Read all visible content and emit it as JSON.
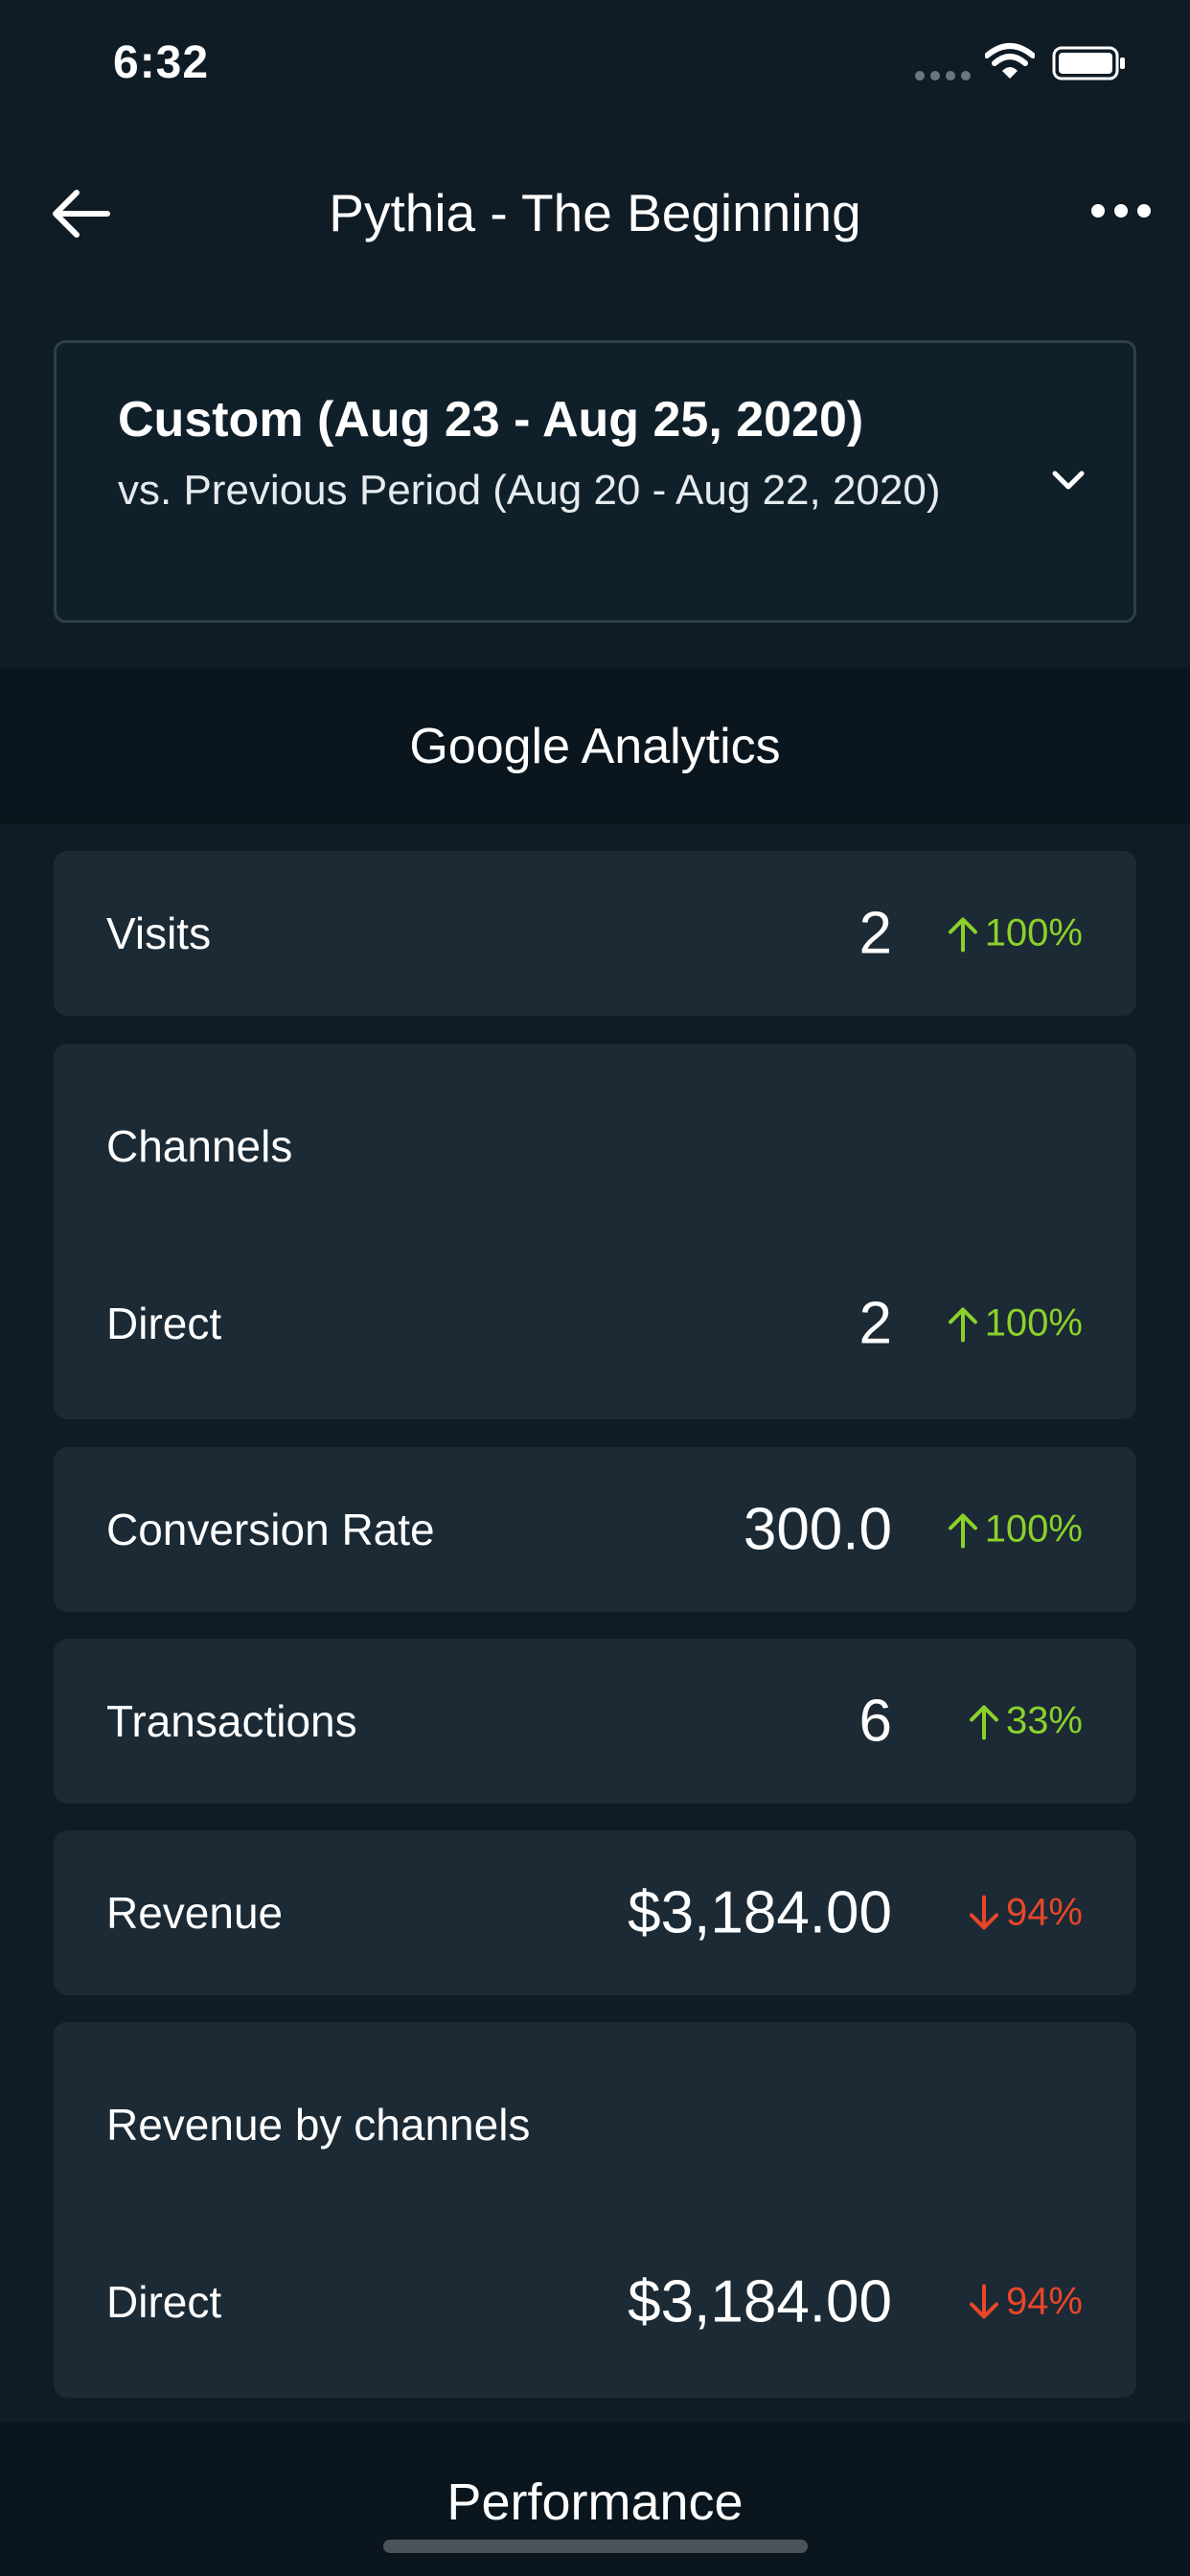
{
  "status_bar": {
    "time": "6:32"
  },
  "header": {
    "title": "Pythia - The Beginning"
  },
  "date_range": {
    "primary": "Custom (Aug 23 - Aug 25, 2020)",
    "comparison": "vs. Previous Period (Aug 20 - Aug 22, 2020)"
  },
  "section": {
    "title": "Google Analytics"
  },
  "metrics": {
    "visits": {
      "label": "Visits",
      "value": "2",
      "delta": "100%",
      "direction": "up"
    },
    "channels": {
      "title": "Channels",
      "rows": [
        {
          "label": "Direct",
          "value": "2",
          "delta": "100%",
          "direction": "up"
        }
      ]
    },
    "conversion_rate": {
      "label": "Conversion Rate",
      "value": "300.0",
      "delta": "100%",
      "direction": "up"
    },
    "transactions": {
      "label": "Transactions",
      "value": "6",
      "delta": "33%",
      "direction": "up"
    },
    "revenue": {
      "label": "Revenue",
      "value": "$3,184.00",
      "delta": "94%",
      "direction": "down"
    },
    "revenue_by_channels": {
      "title": "Revenue by channels",
      "rows": [
        {
          "label": "Direct",
          "value": "$3,184.00",
          "delta": "94%",
          "direction": "down"
        }
      ]
    }
  },
  "bottom_tab": {
    "label": "Performance"
  },
  "colors": {
    "background": "#0f1b25",
    "card": "#1b2a35",
    "positive": "#8bd12a",
    "negative": "#e8462a"
  },
  "icons": {
    "back": "arrow-left-icon",
    "more": "more-horizontal-icon",
    "dropdown": "chevron-down-icon",
    "up": "arrow-up-icon",
    "down": "arrow-down-icon"
  }
}
